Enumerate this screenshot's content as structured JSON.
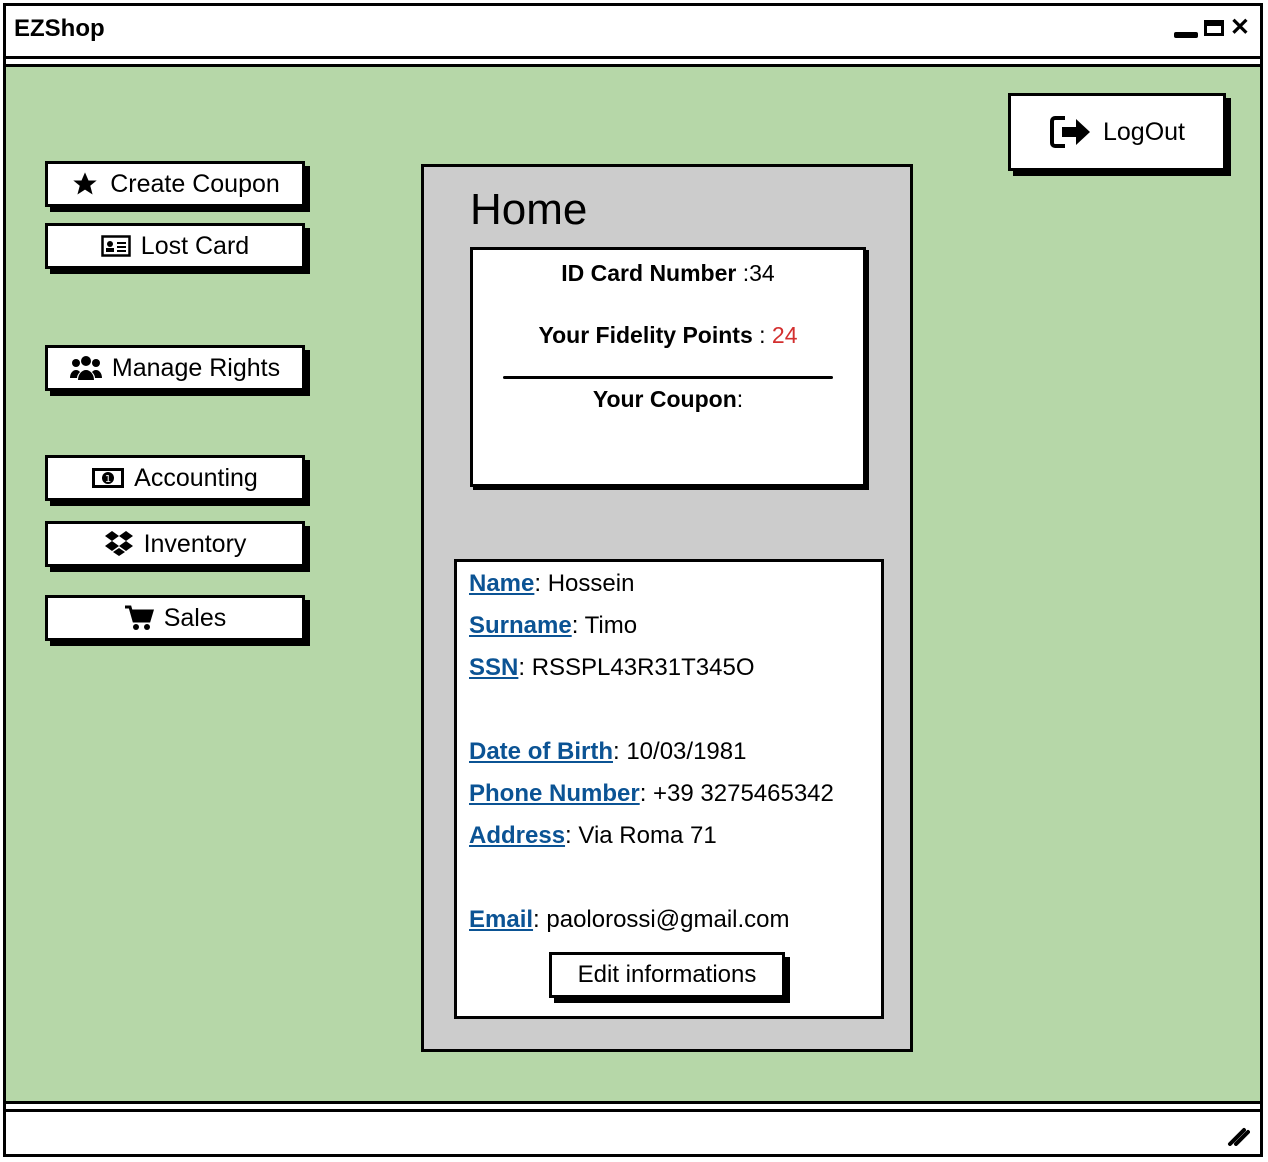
{
  "window": {
    "title": "EZShop"
  },
  "sidebar": {
    "create_coupon": "Create Coupon",
    "lost_card": "Lost Card",
    "manage_rights": "Manage Rights",
    "accounting": "Accounting",
    "inventory": "Inventory",
    "sales": "Sales"
  },
  "header": {
    "logout": "LogOut"
  },
  "home": {
    "title": "Home",
    "card": {
      "id_label": "ID Card Number",
      "id_value": " :34",
      "points_label": "Your Fidelity Points",
      "points_sep": " : ",
      "points_value": "24",
      "coupon_label": "Your Coupon",
      "coupon_sep": ":"
    },
    "info": {
      "name_label": "Name",
      "name_value": ": Hossein",
      "surname_label": "Surname",
      "surname_value": ": Timo",
      "ssn_label": "SSN",
      "ssn_value": ": RSSPL43R31T345O",
      "dob_label": "Date of Birth",
      "dob_value": ": 10/03/1981",
      "phone_label": "Phone Number",
      "phone_value": ": +39 3275465342",
      "address_label": "Address",
      "address_value": ": Via Roma 71",
      "email_label": "Email",
      "email_value": ": paolorossi@gmail.com",
      "edit_button": "Edit informations"
    }
  },
  "colors": {
    "background": "#b6d7a8",
    "link": "#0b5394",
    "points": "#d32f2f",
    "panel": "#cccccc"
  }
}
